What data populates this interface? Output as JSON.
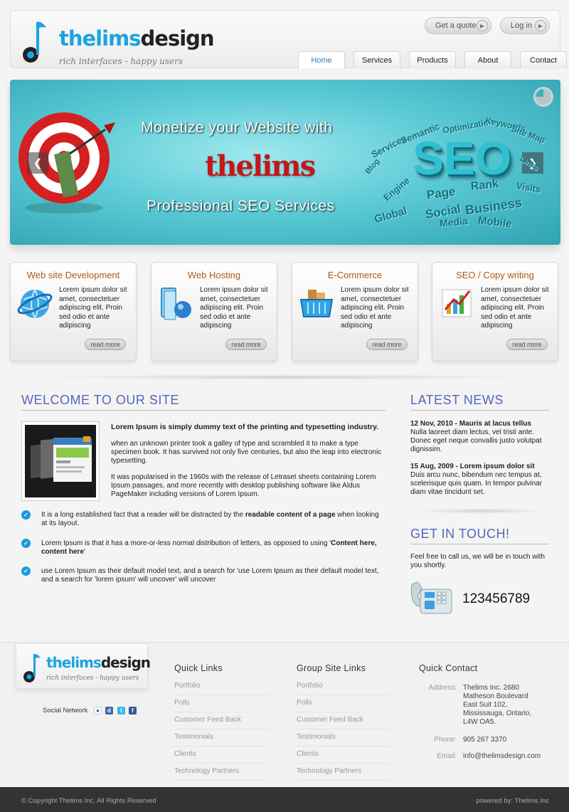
{
  "header": {
    "brand_part1": "thelims",
    "brand_part2": "design",
    "tagline": "rich interfaces - happy users",
    "quote_label": "Get a quote",
    "login_label": "Log in"
  },
  "nav": {
    "items": [
      {
        "label": "Home"
      },
      {
        "label": "Services"
      },
      {
        "label": "Products"
      },
      {
        "label": "About"
      },
      {
        "label": "Contact"
      }
    ]
  },
  "banner": {
    "line1": "Monetize your Website with",
    "brand": "thelims",
    "line2": "Professional SEO Services",
    "seo_big": "SEO",
    "cloud_words": [
      "Services",
      "Semantic",
      "Optimization",
      "Keywords",
      "Site Map",
      "Page",
      "Rank",
      "Visits",
      "Social",
      "Business",
      "Global",
      "Media",
      "Mobile",
      "Engine",
      "Blog",
      "Links"
    ],
    "prev_icon": "chevron-left-icon",
    "next_icon": "chevron-right-icon"
  },
  "services": [
    {
      "title": "Web site Development",
      "text": "Lorem ipsum dolor sit amet, consectetuer adipiscing elit. Proin sed odio et ante adipiscing",
      "button": "read more",
      "icon": "globe-icon"
    },
    {
      "title": "Web Hosting",
      "text": "Lorem ipsum dolor sit amet, consectetuer adipiscing elit. Proin sed odio et ante adipiscing",
      "button": "read more",
      "icon": "hosting-icon"
    },
    {
      "title": "E-Commerce",
      "text": "Lorem ipsum dolor sit amet, consectetuer adipiscing elit. Proin sed odio et ante adipiscing",
      "button": "read more",
      "icon": "basket-icon"
    },
    {
      "title": "SEO / Copy writing",
      "text": "Lorem ipsum dolor sit amet, consectetuer adipiscing elit. Proin sed odio et ante adipiscing",
      "button": "read more",
      "icon": "chart-icon"
    }
  ],
  "welcome": {
    "title": "WELCOME TO OUR SITE",
    "lead": "Lorem Ipsum is simply dummy text of the printing and typesetting industry.",
    "p1": "when an unknown printer took a galley of type and scrambled it to make a type specimen book. It has survived not only five centuries, but also the leap into electronic typesetting.",
    "p2": "It was popularised in the 1960s with the release of Letraset sheets containing Lorem Ipsum passages, and more recently with desktop publishing software like Aldus PageMaker including versions of Lorem Ipsum.",
    "b1_pre": "It is a long established fact that a reader will be distracted by the ",
    "b1_bold": "readable content of a page",
    "b1_post": " when looking at its layout.",
    "b2_pre": "Lorem Ipsum is that it has a more-or-less normal distribution of letters, as opposed to using '",
    "b2_bold": "Content here, content here",
    "b2_post": "'",
    "b3": "use Lorem Ipsum as their default model text, and a search for 'use Lorem Ipsum as their default model text, and a search for 'lorem ipsum' will uncover' will uncover"
  },
  "news": {
    "title": "LATEST NEWS",
    "items": [
      {
        "head": "12 Nov, 2010 - Mauris at lacus tellus",
        "body": "Nulla laoreet diam lectus, vel tristi ante. Donec eget neque convallis justo volutpat dignissim."
      },
      {
        "head": "15 Aug, 2009 - Lorem ipsum dolor sit",
        "body": "Duis arcu nunc, bibendum nec tempus at, scelerisque quis quam. In tempor pulvinar diam vitae tincidunt set."
      }
    ]
  },
  "touch": {
    "title": "GET IN TOUCH!",
    "text": "Feel free to call us, we will be in touch with you shortly.",
    "phone": "123456789"
  },
  "footer": {
    "brand_part1": "thelims",
    "brand_part2": "design",
    "tagline": "rich interfaces - happy users",
    "social_label": "Social Network",
    "quick_links_title": "Quick Links",
    "quick_links": [
      "Portfolio",
      "Polls",
      "Customer Feed Back",
      "Testimonials",
      "Clients",
      "Technology Partners"
    ],
    "group_links_title": "Group Site Links",
    "group_links": [
      "Portfolio",
      "Polls",
      "Customer Feed Back",
      "Testimonials",
      "Clients",
      "Technology Partners"
    ],
    "contact_title": "Quick Contact",
    "address_label": "Address:",
    "address_lines": [
      "Thelims Inc. 2680",
      "Matheson Boulevard",
      "East Suit 102,",
      "Mississauga, Ontario,",
      "L4W OA5."
    ],
    "phone_label": "Phone:",
    "phone": "905 267 3370",
    "email_label": "Email:",
    "email": "info@thelimsdesign.com",
    "copyright": "© Copyright Thelims Inc. All Rights Reserved",
    "powered": "powered by: Thelims Inc"
  },
  "colors": {
    "brand_blue": "#1da3e0",
    "heading_purple": "#5565b8",
    "service_title_orange": "#b05a10",
    "banner_teal": "#5ccbd6"
  }
}
